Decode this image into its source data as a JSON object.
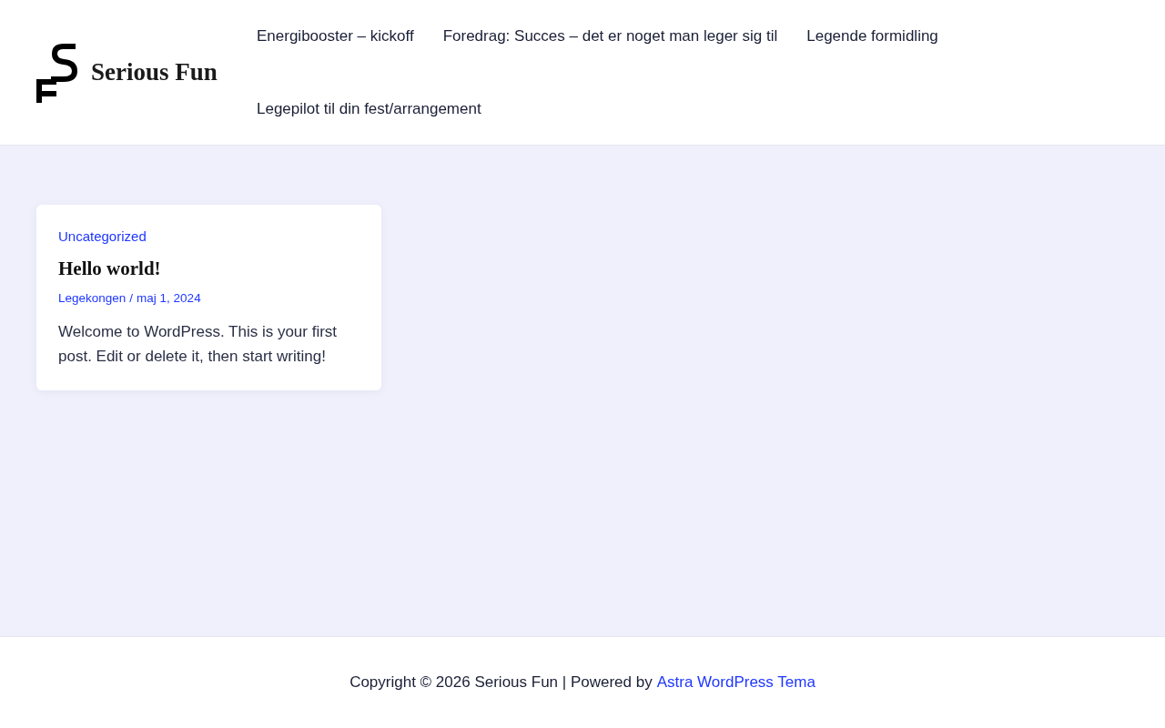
{
  "header": {
    "site_title": "Serious Fun",
    "nav": [
      {
        "label": "Energibooster – kickoff"
      },
      {
        "label": "Foredrag: Succes – det er noget man leger sig til"
      },
      {
        "label": "Legende formidling"
      },
      {
        "label": "Legepilot til din fest/arrangement"
      }
    ]
  },
  "posts": [
    {
      "category": "Uncategorized",
      "title": "Hello world!",
      "author": "Legekongen",
      "separator": "/",
      "date": "maj 1, 2024",
      "excerpt": "Welcome to WordPress. This is your first post. Edit or delete it, then start writing!"
    }
  ],
  "footer": {
    "text": "Copyright © 2026 Serious Fun | Powered by",
    "link": "Astra WordPress Tema"
  }
}
